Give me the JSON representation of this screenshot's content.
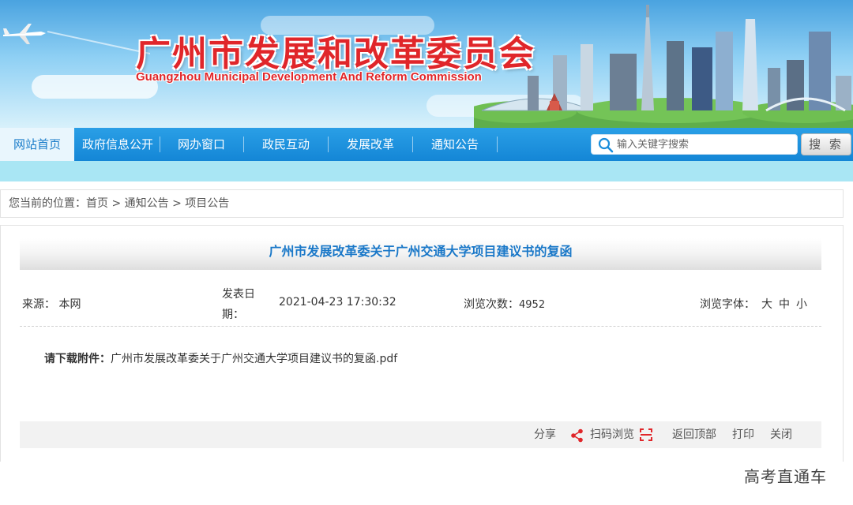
{
  "banner": {
    "title_cn": "广州市发展和改革委员会",
    "title_en": "Guangzhou Municipal Development And Reform Commission",
    "accent_color": "#e0262a"
  },
  "nav": {
    "items": [
      {
        "label": "网站首页",
        "active": true
      },
      {
        "label": "政府信息公开",
        "active": false
      },
      {
        "label": "网办窗口",
        "active": false
      },
      {
        "label": "政民互动",
        "active": false
      },
      {
        "label": "发展改革",
        "active": false
      },
      {
        "label": "通知公告",
        "active": false
      }
    ],
    "color": "#1a8ddb"
  },
  "search": {
    "placeholder": "输入关键字搜索",
    "button_label": "搜 索",
    "icon": "search-icon"
  },
  "breadcrumb": {
    "prefix": "您当前的位置：",
    "items": [
      "首页",
      "通知公告",
      "项目公告"
    ],
    "separator": ">"
  },
  "article": {
    "title": "广州市发展改革委关于广州交通大学项目建议书的复函",
    "source_label": "来源：",
    "source_value": "本网",
    "date_label_line1": "发表日",
    "date_label_line2": "期：",
    "date_value": "2021-04-23 17:30:32",
    "views_label": "浏览次数：",
    "views_value": "4952",
    "font_label": "浏览字体：",
    "font_sizes": [
      "大",
      "中",
      "小"
    ],
    "attachment_label": "请下载附件：",
    "attachment_file": "广州市发展改革委关于广州交通大学项目建议书的复函.pdf",
    "title_color": "#1a78c8"
  },
  "tools": {
    "share": "分享",
    "scan": "扫码浏览",
    "back_top": "返回顶部",
    "print": "打印",
    "close": "关闭",
    "share_icon": "share-icon",
    "qr_icon": "qr-scan-icon"
  },
  "watermark": "高考直通车"
}
